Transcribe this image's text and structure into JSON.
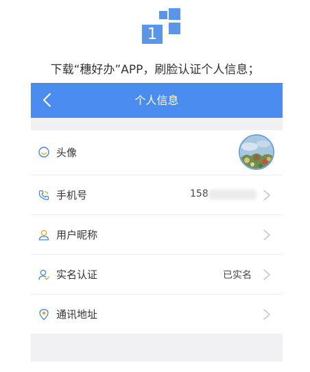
{
  "step": {
    "number": "1"
  },
  "instruction": "下载“穗好办”APP，刷脸认证个人信息；",
  "screen": {
    "header": {
      "title": "个人信息",
      "back_icon": "chevron-left-icon"
    },
    "rows": [
      {
        "label": "头像",
        "icon": "smiley-icon",
        "value": "",
        "has_chevron": false
      },
      {
        "label": "手机号",
        "icon": "phone-icon",
        "value": "158",
        "has_chevron": true
      },
      {
        "label": "用户昵称",
        "icon": "user-icon",
        "value": "",
        "has_chevron": true
      },
      {
        "label": "实名认证",
        "icon": "verified-user-icon",
        "value": "已实名",
        "has_chevron": true
      },
      {
        "label": "通讯地址",
        "icon": "location-pin-icon",
        "value": "",
        "has_chevron": true
      }
    ]
  },
  "colors": {
    "accent": "#4a8cf0",
    "badge": "#5b95e9",
    "icon_blue": "#3f86ef",
    "icon_orange": "#f0a020"
  }
}
